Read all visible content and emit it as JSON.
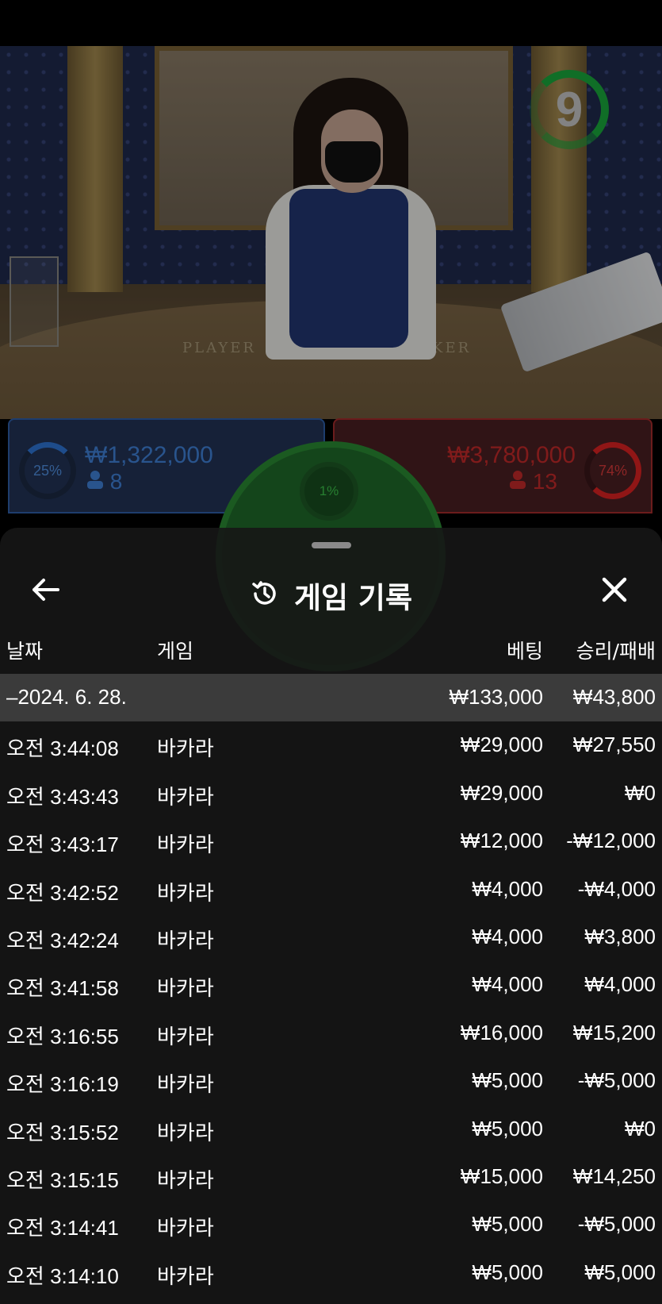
{
  "timer": {
    "seconds": "9"
  },
  "bets": {
    "player": {
      "percent": "25%",
      "amount": "₩1,322,000",
      "count": "8",
      "color": "#2f76d6"
    },
    "banker": {
      "percent": "74%",
      "amount": "₩3,780,000",
      "count": "13",
      "color": "#d22222"
    },
    "tie": {
      "percent": "1%",
      "color": "#2a8a34"
    }
  },
  "table_labels": {
    "player": "PLAYER",
    "banker": "KER"
  },
  "sheet": {
    "title": "게임 기록",
    "columns": {
      "date": "날짜",
      "game": "게임",
      "bet": "베팅",
      "result": "승리/패배"
    },
    "group": {
      "date": "–2024. 6. 28.",
      "bet": "₩133,000",
      "result": "₩43,800"
    },
    "rows": [
      {
        "time": "오전 3:44:08",
        "game": "바카라",
        "bet": "₩29,000",
        "result": "₩27,550"
      },
      {
        "time": "오전 3:43:43",
        "game": "바카라",
        "bet": "₩29,000",
        "result": "₩0"
      },
      {
        "time": "오전 3:43:17",
        "game": "바카라",
        "bet": "₩12,000",
        "result": "-₩12,000"
      },
      {
        "time": "오전 3:42:52",
        "game": "바카라",
        "bet": "₩4,000",
        "result": "-₩4,000"
      },
      {
        "time": "오전 3:42:24",
        "game": "바카라",
        "bet": "₩4,000",
        "result": "₩3,800"
      },
      {
        "time": "오전 3:41:58",
        "game": "바카라",
        "bet": "₩4,000",
        "result": "₩4,000"
      },
      {
        "time": "오전 3:16:55",
        "game": "바카라",
        "bet": "₩16,000",
        "result": "₩15,200"
      },
      {
        "time": "오전 3:16:19",
        "game": "바카라",
        "bet": "₩5,000",
        "result": "-₩5,000"
      },
      {
        "time": "오전 3:15:52",
        "game": "바카라",
        "bet": "₩5,000",
        "result": "₩0"
      },
      {
        "time": "오전 3:15:15",
        "game": "바카라",
        "bet": "₩15,000",
        "result": "₩14,250"
      },
      {
        "time": "오전 3:14:41",
        "game": "바카라",
        "bet": "₩5,000",
        "result": "-₩5,000"
      },
      {
        "time": "오전 3:14:10",
        "game": "바카라",
        "bet": "₩5,000",
        "result": "₩5,000"
      }
    ]
  },
  "icons": {
    "back": "arrow-left-icon",
    "history": "history-icon",
    "close": "close-icon",
    "user": "user-icon"
  }
}
